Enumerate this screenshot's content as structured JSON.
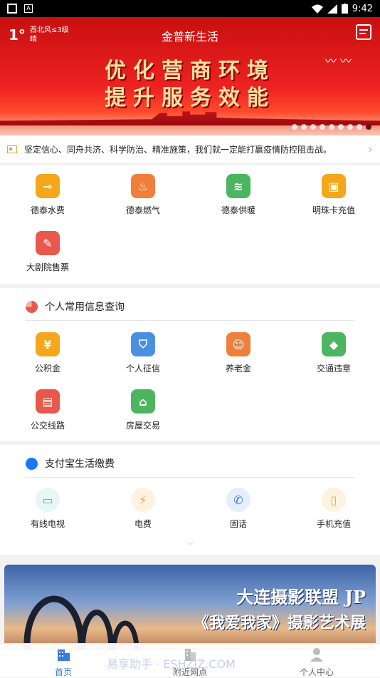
{
  "status_bar": {
    "time": "9:42"
  },
  "header": {
    "temperature": "1°",
    "wind": "西北风≤3级",
    "weather": "晴",
    "title": "金普新生活",
    "banner_line1": "优化营商环境",
    "banner_line2": "提升服务效能",
    "slide_count": 9,
    "active_slide": 9
  },
  "notice": {
    "text": "坚定信心、同舟共济、科学防治、精准施策，我们就一定能打赢疫情防控阻击战。"
  },
  "services": [
    {
      "label": "德泰水费",
      "icon": "faucet-icon",
      "color": "#f5a71b"
    },
    {
      "label": "德泰燃气",
      "icon": "flame-icon",
      "color": "#f07f3b"
    },
    {
      "label": "德泰供暖",
      "icon": "heater-icon",
      "color": "#4cb55f"
    },
    {
      "label": "明珠卡充值",
      "icon": "bus-icon",
      "color": "#f5a71b"
    },
    {
      "label": "大剧院售票",
      "icon": "ticket-icon",
      "color": "#e8584b"
    }
  ],
  "personal": {
    "title": "个人常用信息查询",
    "items": [
      {
        "label": "公积金",
        "icon": "yen-icon",
        "color": "#f5a71b"
      },
      {
        "label": "个人征信",
        "icon": "shield-icon",
        "color": "#4a90e2"
      },
      {
        "label": "养老金",
        "icon": "elder-icon",
        "color": "#f07f3b"
      },
      {
        "label": "交通违章",
        "icon": "warning-sign-icon",
        "color": "#4cb55f"
      },
      {
        "label": "公交线路",
        "icon": "bus-route-icon",
        "color": "#e8584b"
      },
      {
        "label": "房屋交易",
        "icon": "house-icon",
        "color": "#4cb55f"
      }
    ]
  },
  "alipay": {
    "title": "支付宝生活缴费",
    "items": [
      {
        "label": "有线电视",
        "icon": "tv-icon",
        "color": "#2fc8a8",
        "bg": "#e6f8f4"
      },
      {
        "label": "电费",
        "icon": "lightning-icon",
        "color": "#f5a71b",
        "bg": "#fdf3e0"
      },
      {
        "label": "固话",
        "icon": "phone-icon",
        "color": "#3a7be0",
        "bg": "#e6eefb"
      },
      {
        "label": "手机充值",
        "icon": "mobile-icon",
        "color": "#f5a71b",
        "bg": "#fdf3e0"
      }
    ]
  },
  "promo": {
    "line1": "大连摄影联盟 JP",
    "line2": "《我爱我家》摄影艺术展"
  },
  "tabs": [
    {
      "label": "首页",
      "icon": "building-icon"
    },
    {
      "label": "附近网点",
      "icon": "city-icon"
    },
    {
      "label": "个人中心",
      "icon": "person-icon"
    }
  ],
  "watermark": "易享助手 · ESHZJZ.COM"
}
